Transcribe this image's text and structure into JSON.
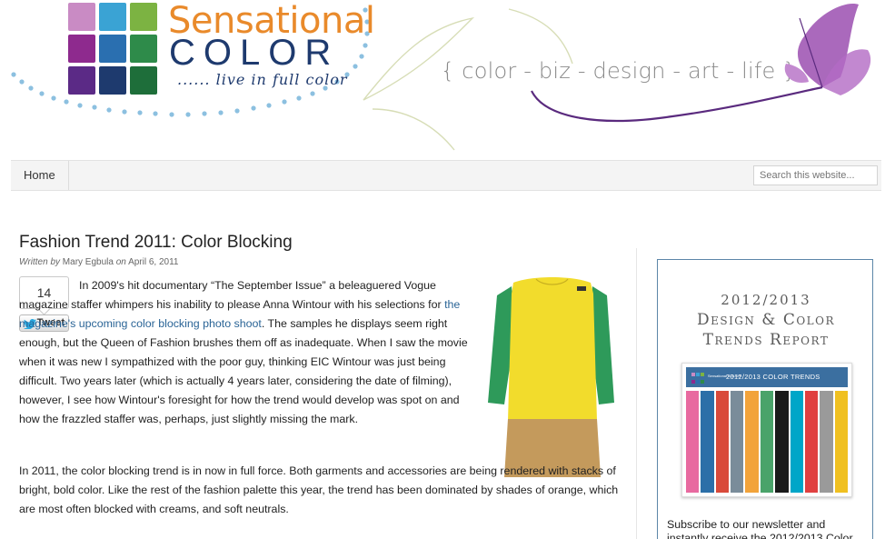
{
  "header": {
    "logo_line1": "Sensational",
    "logo_line2": "COLOR",
    "logo_tagline": "...... live in full color",
    "site_tagline": "{ color - biz - design - art - life }",
    "logo_colors": [
      "#c98bc4",
      "#3aa3d4",
      "#7cb342",
      "#8e2a8e",
      "#2a6fb0",
      "#2e8b4a",
      "#5b2a86",
      "#1e3a6e",
      "#1e6e3a"
    ]
  },
  "nav": {
    "home": "Home",
    "search_placeholder": "Search this website..."
  },
  "post": {
    "title": "Fashion Trend 2011: Color Blocking",
    "byline_written_by": "Written by",
    "author": "Mary Egbula",
    "byline_on": "on",
    "date": "April 6, 2011",
    "tweet_count": "14",
    "tweet_label": "Tweet",
    "p1_before_link": "In 2009's hit documentary “The September Issue” a beleaguered Vogue magazine staffer whimpers his inability to please Anna Wintour with his selections for ",
    "p1_link": "the magazine's upcoming color blocking photo shoot",
    "p1_after_link": ". The samples he displays seem right enough, but the Queen of Fashion brushes them off as inadequate. When I saw the movie when it was new I sympathized with the poor guy, thinking EIC Wintour was just being difficult. Two years later (which is actually 4 years later, considering the date of filming), however, I see how Wintour's foresight for how the trend would develop was spot on and how the frazzled staffer was, perhaps, just slightly missing the mark.",
    "p2": "In 2011, the color blocking trend is in now in full force. Both garments and accessories are being rendered with stacks of bright, bold color. Like the rest of the fashion palette this year, the trend has been dominated by shades of orange, which are most often blocked with creams, and soft neutrals.",
    "dress_colors": {
      "body": "#f2dc2c",
      "sleeves": "#2e9a5a",
      "hem": "#c49a5c"
    }
  },
  "sidebar": {
    "line1": "2012/2013",
    "line2": "Design & Color",
    "line3": "Trends Report",
    "report_header": "2012/2013 COLOR TRENDS",
    "report_logo_text": "Sensational COLOR",
    "stripe_colors": [
      "#e86aa0",
      "#2c6fa8",
      "#d94a3a",
      "#7a8c9a",
      "#f2a33a",
      "#4aa36a",
      "#1a1a1a",
      "#00a6c8",
      "#e04040",
      "#9a9a9a",
      "#f0c020"
    ],
    "subscribe_text": "Subscribe to our newsletter and instantly receive the 2012/2013 Color"
  }
}
